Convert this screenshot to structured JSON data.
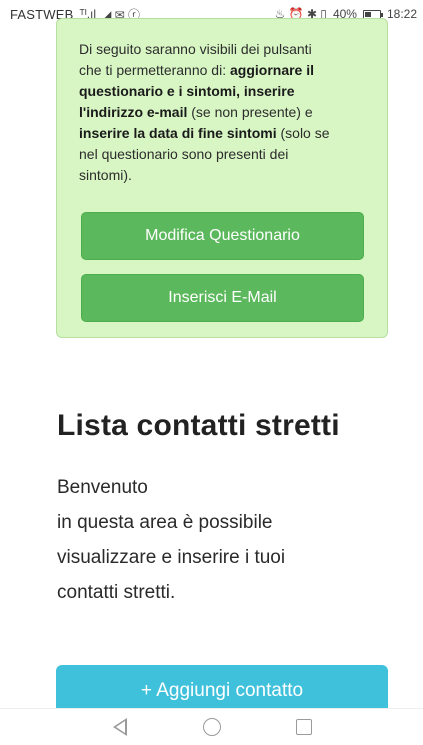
{
  "status_bar": {
    "carrier": "FASTWEB",
    "signal": "ᵀᴵ.ıl",
    "left_icons": "◢ ✉ ⓡ",
    "right_icons": "♨ ⏰ ✱ ▯",
    "battery": "40%",
    "time": "18:22"
  },
  "alert": {
    "t1": "Di seguito saranno visibili dei pulsanti",
    "t2": "che ti permetteranno di: ",
    "t2b": "aggiornare il",
    "t3b": "questionario e i sintomi, inserire",
    "t4b": "l'indirizzo e-mail",
    "t4": " (se non presente) e",
    "t5b": "inserire la data di fine sintomi",
    "t5": " (solo se",
    "t6": "nel questionario sono presenti dei",
    "t7": "sintomi).",
    "edit_button": "Modifica Questionario",
    "email_button": "Inserisci E-Mail"
  },
  "section": {
    "title": "Lista contatti stretti",
    "line1": "Benvenuto",
    "line2": "in questa area è possibile",
    "line3": "visualizzare e inserire i tuoi",
    "line4": "contatti stretti.",
    "add_button": "+ Aggiungi contatto"
  },
  "colors": {
    "alert_bg": "#d8f6c4",
    "green_button": "#5cb85c",
    "blue_button": "#3fc1dc"
  }
}
